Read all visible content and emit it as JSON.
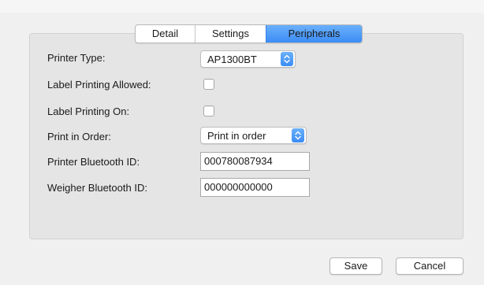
{
  "tabs": {
    "detail": "Detail",
    "settings": "Settings",
    "peripherals": "Peripherals",
    "selected": "Peripherals"
  },
  "form": {
    "printer_type": {
      "label": "Printer Type:",
      "value": "AP1300BT"
    },
    "label_printing_allowed": {
      "label": "Label Printing Allowed:",
      "checked": false
    },
    "label_printing_on": {
      "label": "Label Printing On:",
      "checked": false
    },
    "print_in_order": {
      "label": "Print in Order:",
      "value": "Print in order"
    },
    "printer_bluetooth_id": {
      "label": "Printer Bluetooth ID:",
      "value": "000780087934"
    },
    "weigher_bluetooth_id": {
      "label": "Weigher Bluetooth ID:",
      "value": "000000000000"
    }
  },
  "buttons": {
    "save": "Save",
    "cancel": "Cancel"
  },
  "colors": {
    "accent": "#3b8cf5",
    "panel_background": "#e5e5e5",
    "window_background": "#f0f0f0"
  },
  "icons": {
    "popup_arrow": "chevron-up-down-icon"
  }
}
